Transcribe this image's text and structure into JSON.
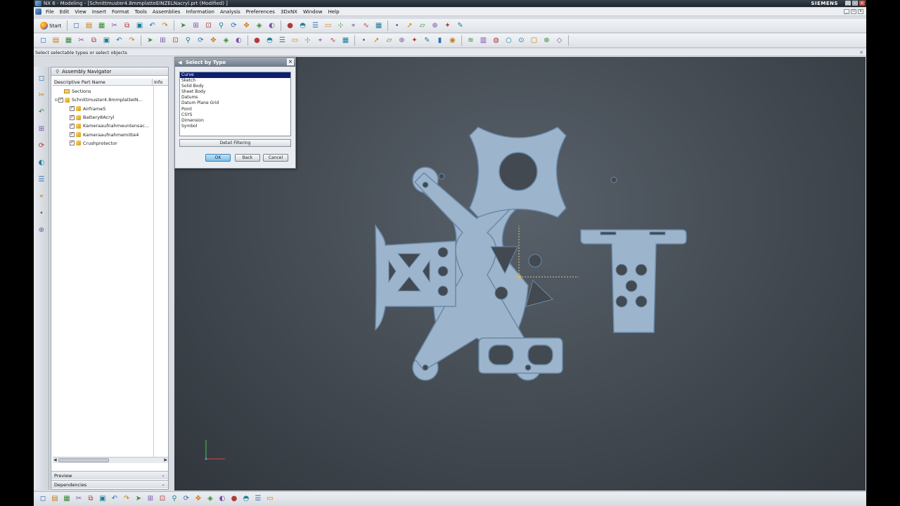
{
  "window": {
    "title": "NX 6 - Modeling - [Schnittmuster4.8mmplatteEINZELNacryl.prt (Modified) ]",
    "brand": "SIEMENS"
  },
  "menu": [
    "File",
    "Edit",
    "View",
    "Insert",
    "Format",
    "Tools",
    "Assemblies",
    "Information",
    "Analysis",
    "Preferences",
    "3DxNX",
    "Window",
    "Help"
  ],
  "toolbar": {
    "start_label": "Start",
    "row1_icons": [
      "new-icon",
      "open-icon",
      "save-icon",
      "cut-icon",
      "copy-icon",
      "paste-icon",
      "undo-icon",
      "redo-icon",
      "select-icon",
      "snap-view-icon",
      "fit-icon",
      "zoom-icon",
      "rotate-icon",
      "pan-icon",
      "orient-icon",
      "render-style-icon",
      "shaded-icon",
      "edge-display-icon",
      "layer-icon",
      "work-view-icon",
      "wcs-icon",
      "measure-icon",
      "analysis-icon",
      "grid-icon",
      "point-icon",
      "vector-icon",
      "plane-icon",
      "csys-icon",
      "feature-icon",
      "sketch-icon"
    ],
    "row2_icons": [
      "extrude-icon",
      "revolve-icon",
      "sweep-icon",
      "block-icon",
      "cylinder-icon",
      "hole-icon",
      "boss-icon",
      "pocket-icon",
      "unite-icon",
      "subtract-icon",
      "blend-icon",
      "chamfer-icon",
      "shell-icon",
      "draft-icon",
      "pattern-icon",
      "mirror-icon",
      "line-icon",
      "arc-icon",
      "circle-icon",
      "trim-icon",
      "offset-icon",
      "project-icon",
      "intersect-icon",
      "extract-icon",
      "thicken-icon",
      "sew-icon",
      "patch-icon",
      "split-icon",
      "trim-body-icon",
      "rule-icon",
      "swept-icon",
      "curve-icon",
      "bridge-icon",
      "move-icon",
      "scale-icon",
      "wrap-icon",
      "sheet-metal-icon",
      "color-icon",
      "hide-icon",
      "show-icon"
    ]
  },
  "cue_line": "Select selectable types or select objects",
  "resource_bar": [
    "assembly-navigator-icon",
    "constraint-navigator-icon",
    "part-navigator-icon",
    "web-browser-icon",
    "history-icon",
    "process-studio-icon",
    "materials-icon",
    "reuse-library-icon",
    "roles-icon",
    "system-scenes-icon"
  ],
  "navigator": {
    "title": "Assembly Navigator",
    "columns": [
      "Descriptive Part Name",
      "Info"
    ],
    "items": [
      {
        "label": "Sections",
        "type": "folder",
        "indent": 1
      },
      {
        "label": "Schnittmuster4.8mmplatteIN...",
        "type": "assembly",
        "indent": 0
      },
      {
        "label": "Airframe5",
        "type": "part",
        "indent": 2
      },
      {
        "label": "Battery8Acryl",
        "type": "part",
        "indent": 2
      },
      {
        "label": "Kameraaufnahmeuntensac...",
        "type": "part",
        "indent": 2
      },
      {
        "label": "Kameraaufnahmemitte4",
        "type": "part",
        "indent": 2
      },
      {
        "label": "Crushprotector",
        "type": "part",
        "indent": 2
      }
    ],
    "panels": [
      "Preview",
      "Dependencies"
    ]
  },
  "dialog": {
    "title": "Select by Type",
    "types": [
      "Curve",
      "Sketch",
      "Solid Body",
      "Sheet Body",
      "Datums",
      "Datum Plane Grid",
      "Point",
      "CSYS",
      "Dimension",
      "Symbol"
    ],
    "selected": "Curve",
    "detail_label": "Detail Filtering",
    "ok_label": "OK",
    "back_label": "Back",
    "cancel_label": "Cancel"
  },
  "bottom_icons": [
    "snap-endpoint-icon",
    "snap-midpoint-icon",
    "snap-control-icon",
    "snap-intersection-icon",
    "snap-center-icon",
    "snap-quadrant-icon",
    "snap-existing-icon",
    "snap-on-curve-icon",
    "snap-on-surface-icon",
    "snap-pole-icon",
    "snap-bounded-icon",
    "snap-tangent-icon",
    "snap-arc-icon",
    "snap-face-icon",
    "snap-point-icon",
    "filter-icon",
    "selection-icon",
    "quick-pick-icon",
    "view-triad-icon",
    "work-layer-icon"
  ],
  "colors": {
    "part_fill": "#9db5cc",
    "part_stroke": "#6a89a8",
    "background_center": "#58606a",
    "selection_highlight": "#0d1f73"
  }
}
